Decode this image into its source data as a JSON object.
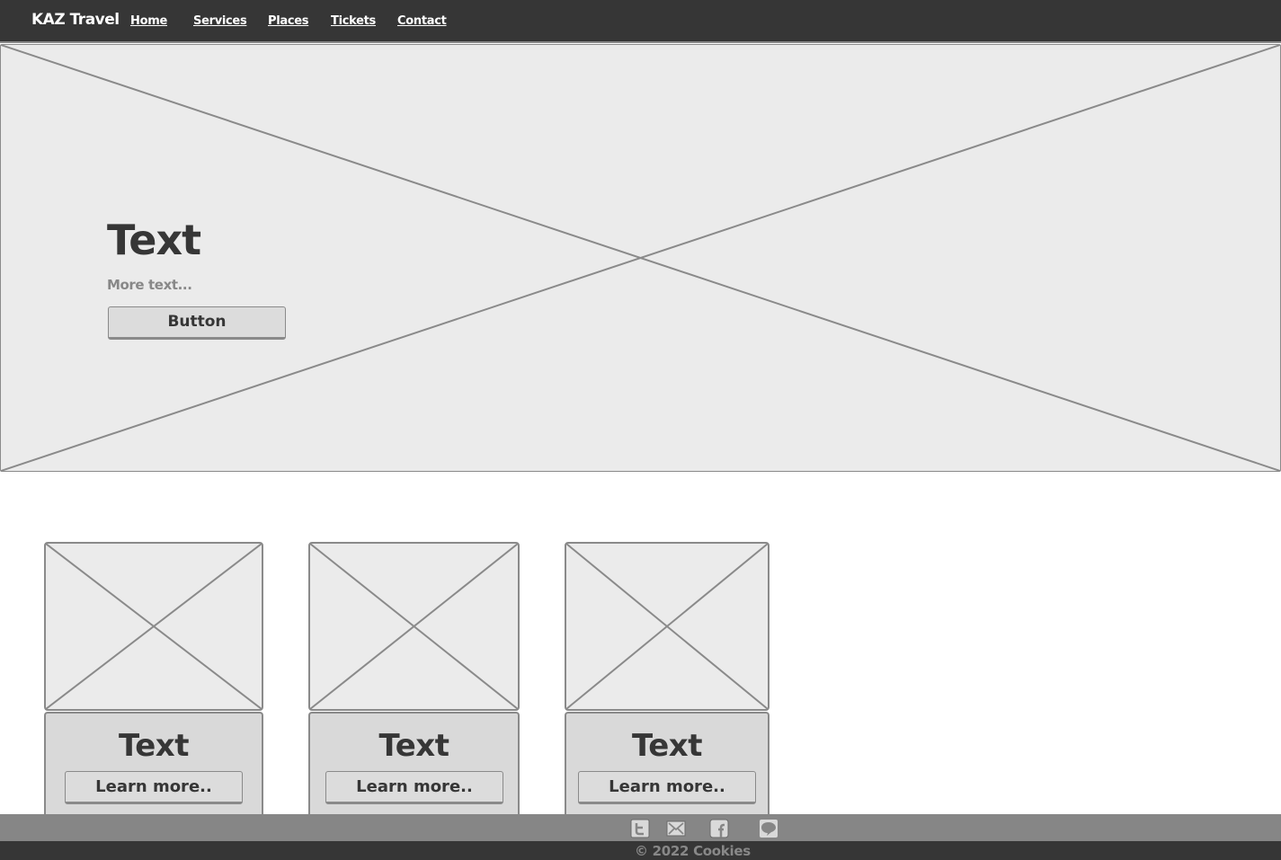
{
  "nav": {
    "brand": "KAZ Travel",
    "links": [
      "Home",
      "Services",
      "Places",
      "Tickets",
      "Contact"
    ]
  },
  "hero": {
    "title": "Text",
    "subtitle": "More text...",
    "button_label": "Button"
  },
  "cards": [
    {
      "title": "Text",
      "button_label": "Learn more.."
    },
    {
      "title": "Text",
      "button_label": "Learn more.."
    },
    {
      "title": "Text",
      "button_label": "Learn more.."
    }
  ],
  "footer": {
    "social_icons": [
      "twitter-icon",
      "email-icon",
      "facebook-icon",
      "chat-icon"
    ],
    "copyright": "© 2022 Cookies"
  },
  "colors": {
    "nav_bg": "#363636",
    "placeholder_bg": "#ebebeb",
    "border": "#8a8a8a",
    "card_body_bg": "#d9d9d9",
    "footer_icon_bar": "#868686"
  }
}
